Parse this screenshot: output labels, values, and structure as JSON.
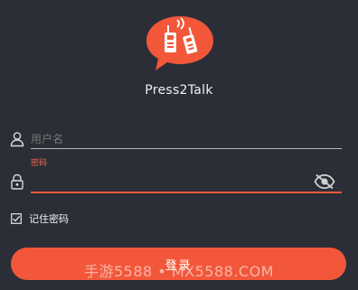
{
  "app": {
    "title": "Press2Talk"
  },
  "form": {
    "username": {
      "placeholder": "用户名",
      "value": ""
    },
    "password": {
      "label": "密码",
      "value": ""
    },
    "remember": {
      "label": "记住密码",
      "checked": true
    }
  },
  "actions": {
    "login_label": "登录"
  },
  "watermark": {
    "text": "手游5588 • MX5588.COM"
  },
  "icons": {
    "logo": "walkie-talkie-bubble-icon",
    "user": "user-icon",
    "lock": "lock-icon",
    "visibility": "eye-slash-icon",
    "checkbox": "checkbox-checked-icon"
  },
  "colors": {
    "background": "#2b2e36",
    "accent": "#f2573a",
    "error": "#f06a4c",
    "text": "#e8e8e8"
  }
}
